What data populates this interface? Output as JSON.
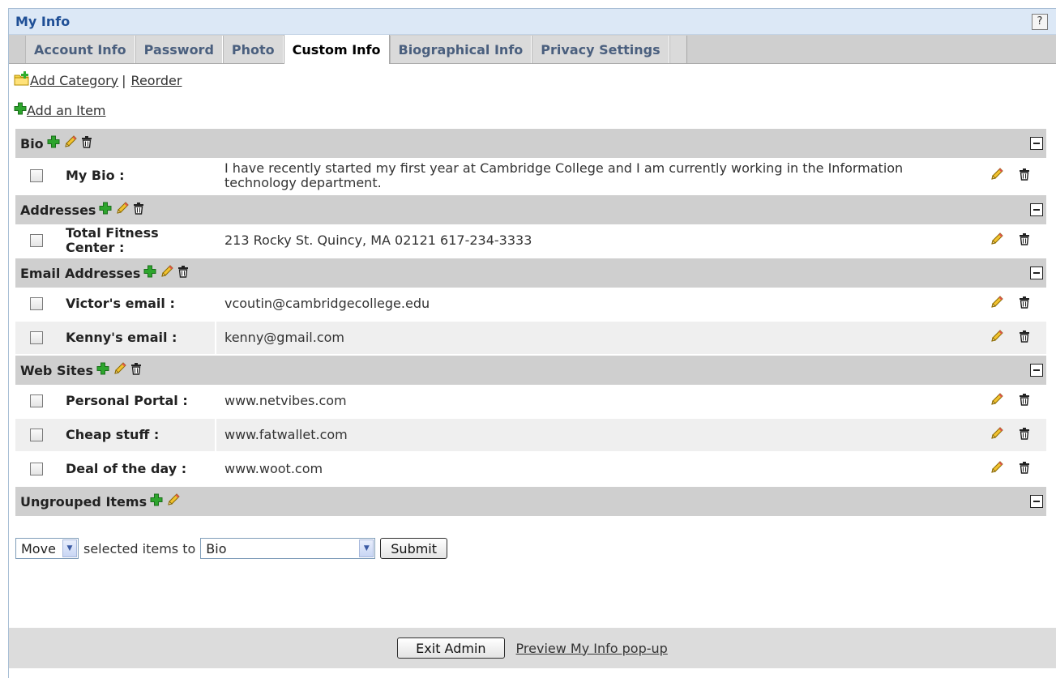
{
  "window": {
    "title": "My Info",
    "help_label": "?"
  },
  "tabs": [
    {
      "label": "Account Info"
    },
    {
      "label": "Password"
    },
    {
      "label": "Photo"
    },
    {
      "label": "Custom Info",
      "active": true
    },
    {
      "label": "Biographical Info"
    },
    {
      "label": "Privacy Settings"
    }
  ],
  "toolbar": {
    "add_category": "Add Category",
    "separator": "|",
    "reorder": "Reorder",
    "add_item": "Add an Item"
  },
  "categories": [
    {
      "name": "Bio",
      "items": [
        {
          "label": "My Bio :",
          "value": "I have recently started my first year at Cambridge College and I am currently working in the Information technology department."
        }
      ]
    },
    {
      "name": "Addresses",
      "items": [
        {
          "label": "Total Fitness Center :",
          "value": "213 Rocky St. Quincy, MA 02121 617-234-3333"
        }
      ]
    },
    {
      "name": "Email Addresses",
      "items": [
        {
          "label": "Victor's email :",
          "value": "vcoutin@cambridgecollege.edu"
        },
        {
          "label": "Kenny's email :",
          "value": "kenny@gmail.com"
        }
      ]
    },
    {
      "name": "Web Sites",
      "items": [
        {
          "label": "Personal Portal :",
          "value": "www.netvibes.com"
        },
        {
          "label": "Cheap stuff :",
          "value": "www.fatwallet.com"
        },
        {
          "label": "Deal of the day :",
          "value": "www.woot.com"
        }
      ]
    },
    {
      "name": "Ungrouped Items",
      "items": []
    }
  ],
  "move_bar": {
    "action_value": "Move",
    "middle_text": "selected items to",
    "target_value": "Bio",
    "submit_label": "Submit"
  },
  "footer": {
    "exit_label": "Exit Admin",
    "preview_link": "Preview My Info pop-up"
  },
  "icons": {
    "add": "plus-icon",
    "edit": "pencil-icon",
    "delete": "trash-icon",
    "folder": "folder-add-icon",
    "collapse": "collapse-icon"
  }
}
